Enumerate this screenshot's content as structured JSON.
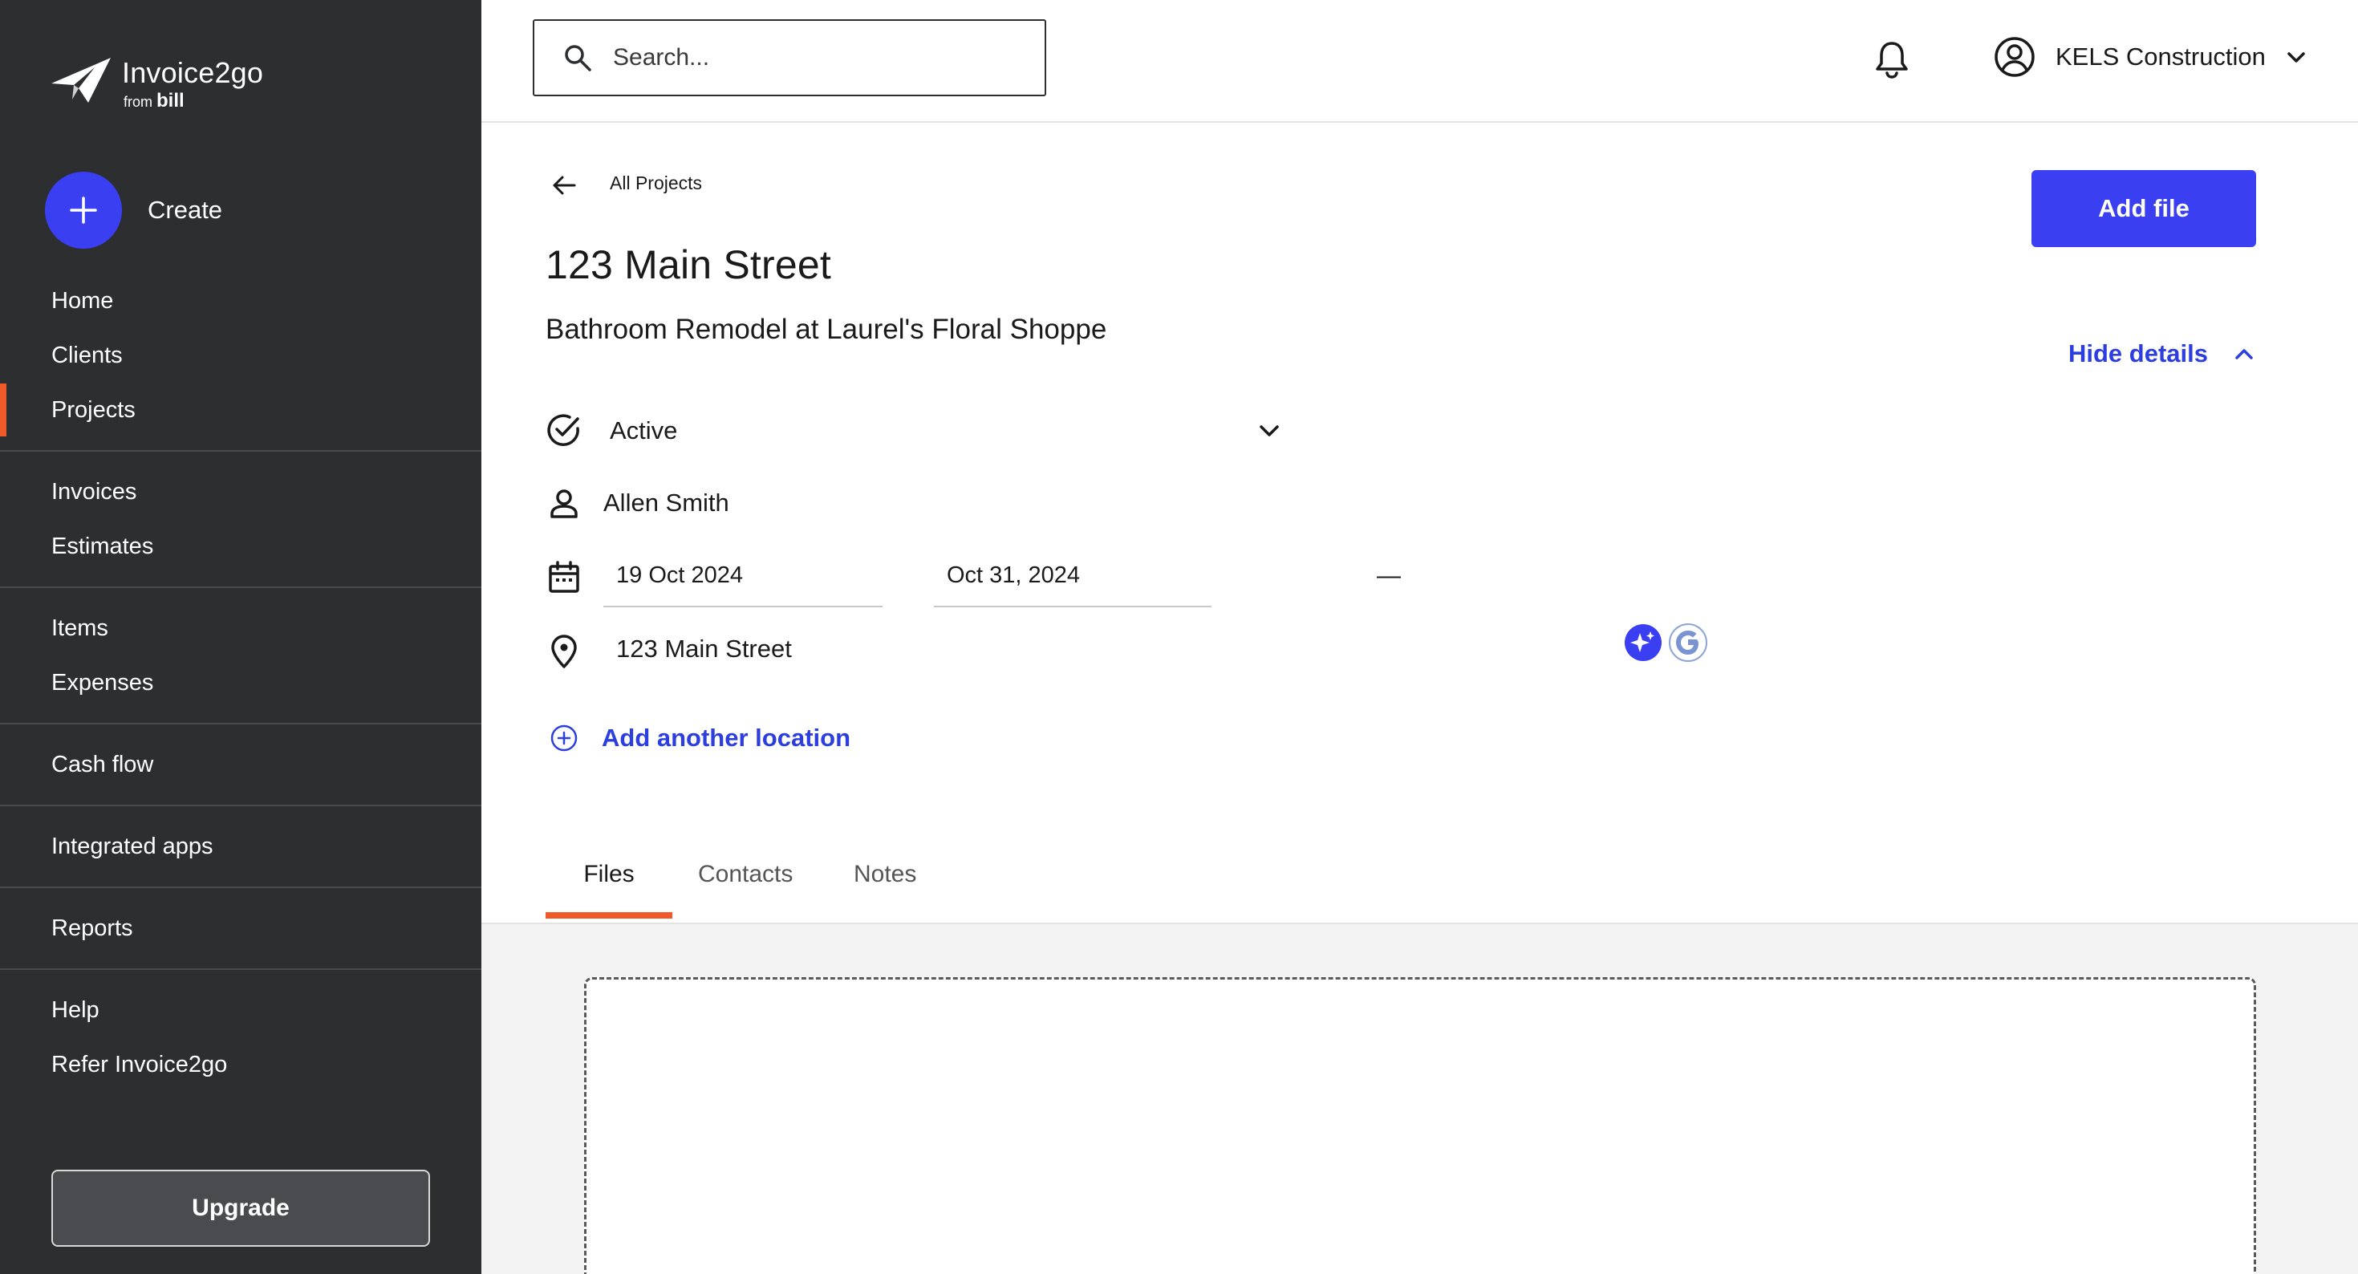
{
  "brand": {
    "name": "Invoice2go",
    "from": "from",
    "parent": "bill"
  },
  "sidebar": {
    "create_label": "Create",
    "items": [
      {
        "label": "Home"
      },
      {
        "label": "Clients"
      },
      {
        "label": "Projects"
      },
      {
        "label": "Invoices"
      },
      {
        "label": "Estimates"
      },
      {
        "label": "Items"
      },
      {
        "label": "Expenses"
      },
      {
        "label": "Cash flow"
      },
      {
        "label": "Integrated apps"
      },
      {
        "label": "Reports"
      },
      {
        "label": "Help"
      },
      {
        "label": "Refer Invoice2go"
      }
    ],
    "upgrade_label": "Upgrade"
  },
  "topbar": {
    "search_placeholder": "Search...",
    "account_name": "KELS Construction"
  },
  "project": {
    "breadcrumb": "All Projects",
    "add_file_label": "Add file",
    "title": "123 Main Street",
    "subtitle": "Bathroom Remodel at Laurel's Floral Shoppe",
    "hide_details_label": "Hide details",
    "status": "Active",
    "owner": "Allen Smith",
    "start_date": "19 Oct 2024",
    "date_separator": "—",
    "end_date": "Oct 31, 2024",
    "location": "123 Main Street",
    "add_location_label": "Add another location"
  },
  "tabs": [
    {
      "label": "Files",
      "active": true
    },
    {
      "label": "Contacts",
      "active": false
    },
    {
      "label": "Notes",
      "active": false
    }
  ],
  "colors": {
    "sidebar_bg": "#2d2e30",
    "accent_blue": "#3a3ff2",
    "link_blue": "#2d3ee0",
    "active_orange": "#f05a28"
  }
}
